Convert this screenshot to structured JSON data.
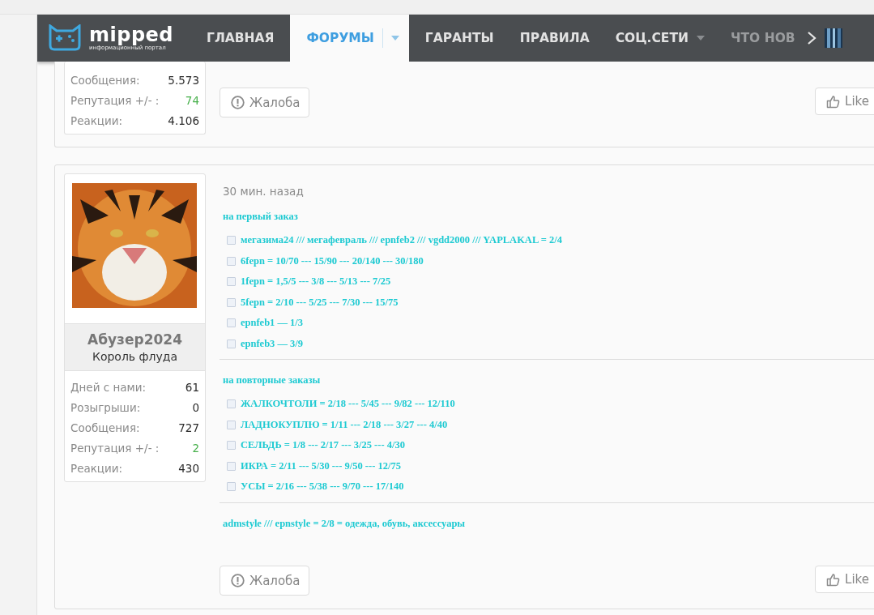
{
  "nav": {
    "logo": "mipped",
    "tagline": "информационный портал",
    "items": [
      {
        "label": "ГЛАВНАЯ",
        "selected": false,
        "dropdown": false,
        "faded": false
      },
      {
        "label": "ФОРУМЫ",
        "selected": true,
        "dropdown": true,
        "faded": false
      },
      {
        "label": "ГАРАНТЫ",
        "selected": false,
        "dropdown": false,
        "faded": false
      },
      {
        "label": "ПРАВИЛА",
        "selected": false,
        "dropdown": false,
        "faded": false
      },
      {
        "label": "СОЦ.СЕТИ",
        "selected": false,
        "dropdown": true,
        "faded": false
      },
      {
        "label": "ЧТО НОВ",
        "selected": false,
        "dropdown": false,
        "faded": true
      }
    ]
  },
  "posts": [
    {
      "stats": [
        {
          "label": "Сообщения:",
          "value": "5.573",
          "positive": false
        },
        {
          "label": "Репутация +/- :",
          "value": "74",
          "positive": true
        },
        {
          "label": "Реакции:",
          "value": "4.106",
          "positive": false
        }
      ],
      "report": "Жалоба",
      "like": "Like"
    },
    {
      "time": "30 мин. назад",
      "author": "Абузер2024",
      "rank": "Король флуда",
      "stats": [
        {
          "label": "Дней с нами:",
          "value": "61",
          "positive": false
        },
        {
          "label": "Розыгрыши:",
          "value": "0",
          "positive": false
        },
        {
          "label": "Сообщения:",
          "value": "727",
          "positive": false
        },
        {
          "label": "Репутация +/- :",
          "value": "2",
          "positive": true
        },
        {
          "label": "Реакции:",
          "value": "430",
          "positive": false
        }
      ],
      "sections": [
        {
          "heading": "на первый заказ",
          "items": [
            "мегазима24 /// мегафевраль /// epnfeb2 /// vgdd2000 /// YAPLAKAL = 2/4",
            "6fepn = 10/70 --- 15/90 --- 20/140 --- 30/180",
            "1fepn = 1,5/5 --- 3/8 --- 5/13 --- 7/25",
            "5fepn = 2/10 --- 5/25 --- 7/30 --- 15/75",
            "epnfeb1 — 1/3",
            "epnfeb3 — 3/9"
          ]
        },
        {
          "heading": "на повторные заказы",
          "items": [
            "ЖАЛКОЧТОЛИ = 2/18 --- 5/45 --- 9/82 --- 12/110",
            "ЛАДНОКУПЛЮ = 1/11 --- 2/18 --- 3/27 --- 4/40",
            "СЕЛЬДЬ = 1/8 --- 2/17 --- 3/25 --- 4/30",
            "ИКРА = 2/11 --- 5/30 --- 9/50 --- 12/75",
            "УСЫ = 2/16 --- 5/38 --- 9/70 --- 17/140"
          ]
        },
        {
          "heading": "admstyle /// epnstyle = 2/8 = одежда, обувь, аксессуары"
        }
      ],
      "report": "Жалоба",
      "like": "Like"
    }
  ]
}
